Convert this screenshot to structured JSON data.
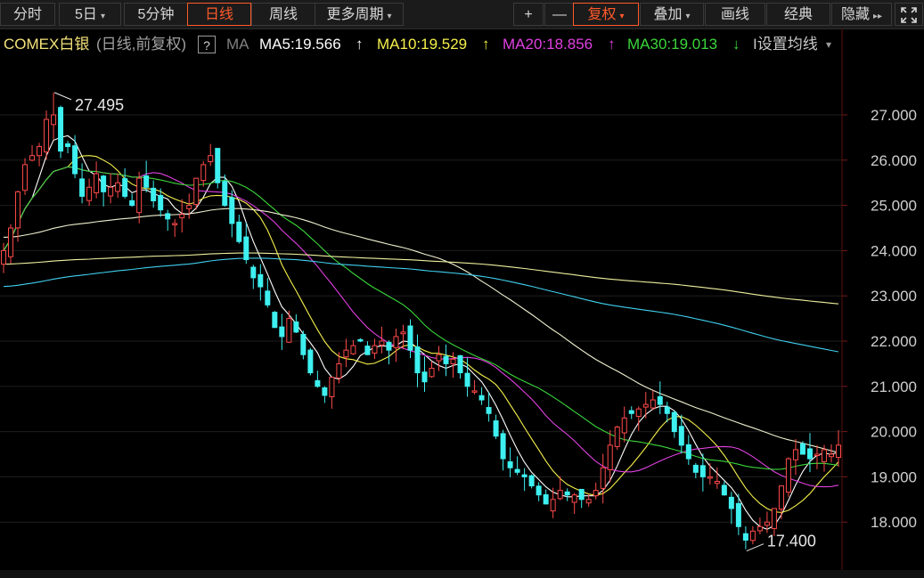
{
  "toolbar": {
    "items": [
      {
        "label": "分时",
        "caret": false,
        "active": false
      },
      {
        "label": "5日",
        "caret": true,
        "active": false
      },
      {
        "label": "5分钟",
        "caret": false,
        "active": false
      },
      {
        "label": "日线",
        "caret": false,
        "active": true
      },
      {
        "label": "周线",
        "caret": false,
        "active": false
      },
      {
        "label": "更多周期",
        "caret": true,
        "active": false
      }
    ],
    "right_items": [
      {
        "label": "+",
        "caret": false,
        "active": false
      },
      {
        "label": "—",
        "caret": false,
        "active": false
      },
      {
        "label": "复权",
        "caret": true,
        "active": true
      },
      {
        "label": "叠加",
        "caret": true,
        "active": false
      },
      {
        "label": "画线",
        "caret": false,
        "active": false
      },
      {
        "label": "经典",
        "caret": false,
        "active": false
      },
      {
        "label": "隐藏",
        "caret": false,
        "active": false
      }
    ],
    "hide_arrows": "▸▸",
    "expand_icon": "expand-icon"
  },
  "legend": {
    "symbol": "COMEX白银",
    "mode": "(日线,前复权)",
    "help": "?",
    "ma_label": "MA",
    "ma5": "MA5:19.566",
    "ma10": "MA10:19.529",
    "ma20": "MA20:18.856",
    "ma30": "MA30:19.013",
    "up_arrow": "↑",
    "down_arrow": "↓",
    "settings": "I设置均线",
    "settings_caret": "▾",
    "colors": {
      "symbol": "#f5e27a",
      "ma5": "#ffffff",
      "ma10": "#f5f04b",
      "ma20": "#e040e0",
      "ma30": "#3ad63a",
      "ma60": "#f0f0d0",
      "ma120": "#40d0f0",
      "ma250": "#f0f0a0"
    }
  },
  "chart_data": {
    "type": "candlestick",
    "title": "",
    "y_ticks": [
      "27.000",
      "26.000",
      "25.000",
      "24.000",
      "23.000",
      "22.000",
      "21.000",
      "20.000",
      "19.000",
      "18.000"
    ],
    "ylim": [
      17.0,
      28.0
    ],
    "annotations": [
      {
        "label": "27.495",
        "value": 27.495,
        "kind": "high"
      },
      {
        "label": "17.400",
        "value": 17.4,
        "kind": "low"
      }
    ],
    "up_color": "#ff4a4a",
    "down_color": "#3ef0f0",
    "close_path": [
      24.0,
      24.5,
      25.3,
      25.9,
      26.1,
      26.3,
      26.9,
      27.0,
      26.2,
      26.3,
      25.7,
      25.2,
      25.4,
      25.7,
      25.3,
      25.4,
      25.5,
      25.2,
      25.0,
      25.6,
      25.4,
      25.1,
      24.9,
      24.7,
      24.6,
      24.8,
      25.0,
      25.6,
      25.9,
      26.1,
      25.5,
      25.0,
      24.6,
      24.2,
      23.8,
      23.4,
      23.2,
      22.8,
      22.3,
      22.1,
      22.5,
      22.2,
      21.7,
      21.3,
      21.0,
      20.8,
      21.2,
      21.5,
      21.8,
      21.9,
      22.0,
      21.7,
      21.9,
      22.0,
      21.8,
      22.1,
      22.2,
      21.8,
      21.3,
      21.1,
      21.4,
      21.7,
      21.5,
      21.6,
      21.3,
      21.0,
      20.9,
      20.7,
      20.4,
      19.9,
      19.4,
      19.2,
      19.1,
      19.0,
      18.8,
      18.6,
      18.4,
      18.5,
      18.7,
      18.6,
      18.6,
      18.5,
      18.5,
      18.7,
      19.2,
      19.7,
      20.1,
      20.3,
      20.4,
      20.5,
      20.6,
      20.7,
      20.6,
      20.4,
      20.0,
      19.7,
      19.4,
      19.1,
      19.0,
      19.0,
      18.9,
      18.6,
      18.3,
      17.9,
      17.6,
      17.8,
      17.9,
      18.0,
      18.3,
      18.8,
      19.4,
      19.6,
      19.5,
      19.4,
      19.5,
      19.6,
      19.5,
      19.7
    ]
  }
}
